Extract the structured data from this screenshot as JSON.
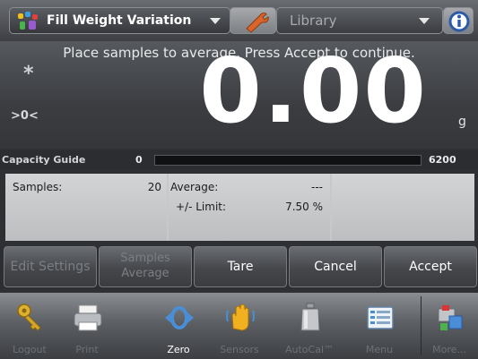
{
  "header": {
    "app_title": "Fill Weight Variation",
    "library_label": "Library"
  },
  "readout": {
    "instruction": "Place samples to average. Press Accept to continue.",
    "stable_indicator": "*",
    "center_zero": ">0<",
    "weight": "0.00",
    "unit": "g"
  },
  "capacity": {
    "label": "Capacity Guide",
    "min": "0",
    "max": "6200",
    "fill_fraction": 0
  },
  "stats": {
    "samples_label": "Samples:",
    "samples_value": "20",
    "average_label": "Average:",
    "average_value": "---",
    "limit_label": "+/- Limit:",
    "limit_value": "7.50 %"
  },
  "buttons": {
    "edit_settings": "Edit Settings",
    "samples_average_1": "Samples",
    "samples_average_2": "Average",
    "tare": "Tare",
    "cancel": "Cancel",
    "accept": "Accept"
  },
  "nav": {
    "logout": "Logout",
    "print": "Print",
    "zero": "Zero",
    "sensors": "Sensors",
    "autocal": "AutoCal™",
    "menu": "Menu",
    "more": "More..."
  },
  "colors": {
    "accent": "#2e3034",
    "disabled_text": "#7b7e82"
  }
}
